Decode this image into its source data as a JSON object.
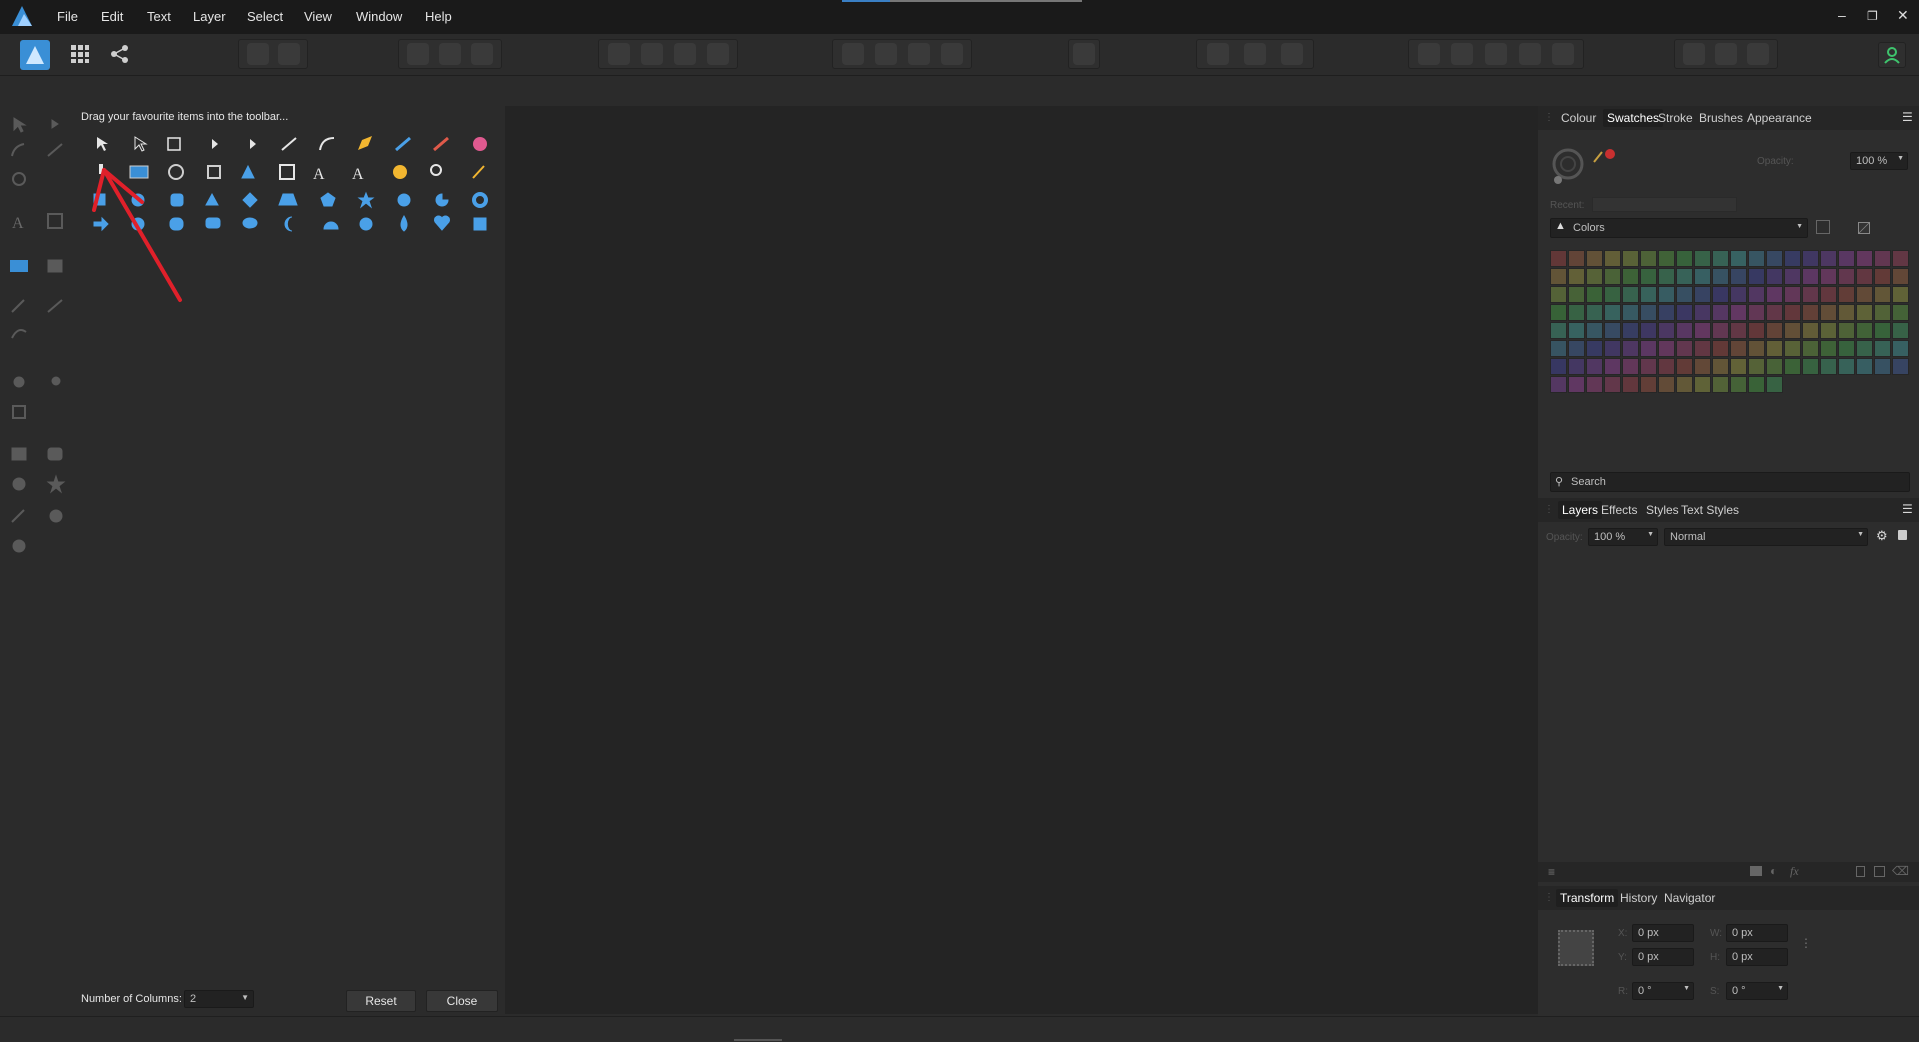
{
  "menu": [
    "File",
    "Edit",
    "Text",
    "Layer",
    "Select",
    "View",
    "Window",
    "Help"
  ],
  "customize": {
    "hint": "Drag your favourite items into the toolbar...",
    "columns_label": "Number of Columns:",
    "columns_value": "2",
    "reset_label": "Reset",
    "close_label": "Close"
  },
  "colour_panel": {
    "tabs": [
      "Colour",
      "Swatches",
      "Stroke",
      "Brushes",
      "Appearance"
    ],
    "active_tab": "Swatches",
    "opacity_label": "Opacity:",
    "opacity_value": "100 %",
    "recent_label": "Recent:",
    "palette_name": "Colors",
    "search_placeholder": "Search"
  },
  "layers_panel": {
    "tabs": [
      "Layers",
      "Effects",
      "Styles",
      "Text Styles"
    ],
    "active_tab": "Layers",
    "opacity_label": "Opacity:",
    "opacity_value": "100 %",
    "blend_mode": "Normal"
  },
  "transform_panel": {
    "tabs": [
      "Transform",
      "History",
      "Navigator"
    ],
    "active_tab": "Transform",
    "x_label": "X:",
    "x_value": "0 px",
    "y_label": "Y:",
    "y_value": "0 px",
    "w_label": "W:",
    "w_value": "0 px",
    "h_label": "H:",
    "h_value": "0 px",
    "r_label": "R:",
    "r_value": "0 °",
    "s_label": "S:",
    "s_value": "0 °"
  },
  "colors": {
    "accent": "#3a8fd6",
    "annotation_arrow": "#e0202a",
    "icon_blue": "#4aa0e8"
  }
}
